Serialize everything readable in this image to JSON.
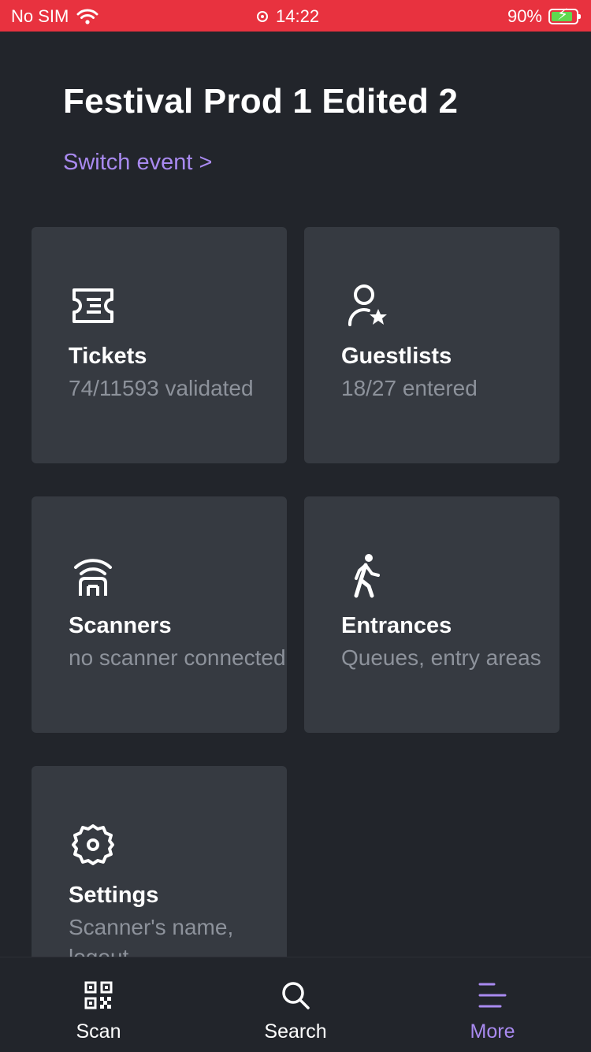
{
  "status_bar": {
    "carrier": "No SIM",
    "time": "14:22",
    "battery_percent": "90%"
  },
  "header": {
    "event_title": "Festival Prod 1 Edited 2",
    "switch_event": "Switch event >"
  },
  "cards": [
    {
      "title": "Tickets",
      "subtitle": "74/11593 validated",
      "icon": "ticket-icon"
    },
    {
      "title": "Guestlists",
      "subtitle": "18/27 entered",
      "icon": "person-star-icon"
    },
    {
      "title": "Scanners",
      "subtitle": "no scanner connected",
      "icon": "wifi-scanner-icon"
    },
    {
      "title": "Entrances",
      "subtitle": "Queues, entry areas",
      "icon": "walking-person-icon"
    },
    {
      "title": "Settings",
      "subtitle": "Scanner's name, logout",
      "icon": "gear-icon"
    }
  ],
  "tab_bar": {
    "tabs": [
      {
        "label": "Scan",
        "icon": "qr-code-icon"
      },
      {
        "label": "Search",
        "icon": "search-icon"
      },
      {
        "label": "More",
        "icon": "menu-lines-icon",
        "active": true
      }
    ]
  },
  "colors": {
    "status_bar": "#e8323f",
    "background": "#22252b",
    "card": "#363a41",
    "accent": "#a98af0",
    "subtitle": "#8d929b"
  }
}
